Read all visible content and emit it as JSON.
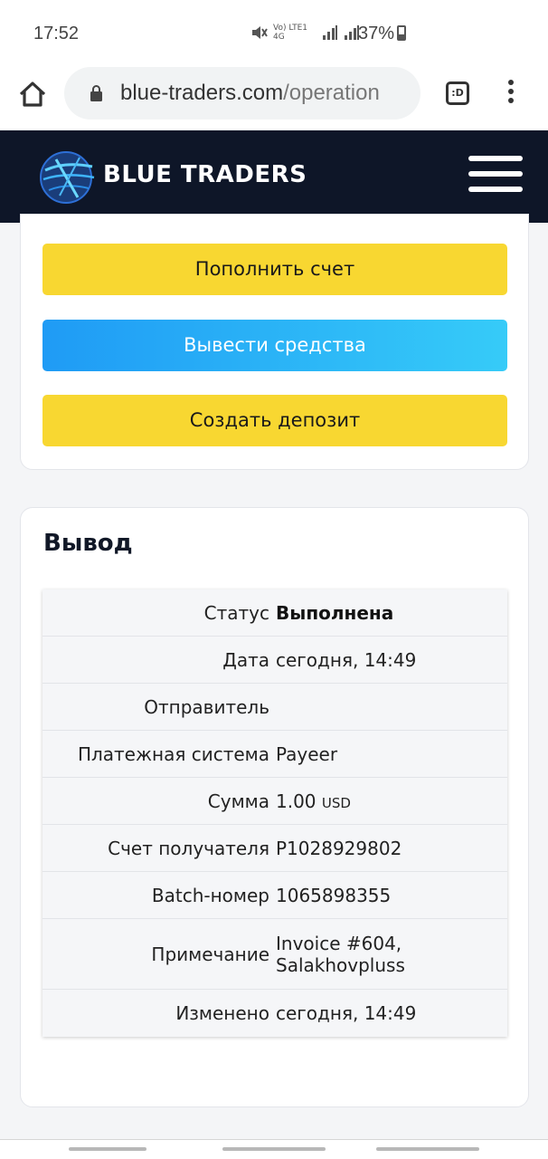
{
  "status_bar": {
    "time": "17:52",
    "network_icons": "Vo) LTE1 4G",
    "battery_percent": "37%"
  },
  "browser": {
    "url_main": "blue-traders.com",
    "url_rest": "/operation",
    "tabs_label": ":D"
  },
  "site": {
    "brand": "BLUE TRADERS"
  },
  "actions": {
    "deposit_label": "Пополнить счет",
    "withdraw_label": "Вывести средства",
    "create_deposit_label": "Создать депозит"
  },
  "withdrawal": {
    "title": "Вывод",
    "rows": [
      {
        "label": "Статус",
        "value": "Выполнена"
      },
      {
        "label": "Дата",
        "value": "сегодня, 14:49"
      },
      {
        "label": "Отправитель",
        "value": ""
      },
      {
        "label": "Платежная система",
        "value": "Payeer"
      },
      {
        "label": "Сумма",
        "value": "1.00",
        "unit": "USD"
      },
      {
        "label": "Счет получателя",
        "value": "P1028929802"
      },
      {
        "label": "Batch-номер",
        "value": "1065898355"
      },
      {
        "label": "Примечание",
        "value": "Invoice #604, Salakhovpluss"
      },
      {
        "label": "Изменено",
        "value": "сегодня, 14:49"
      }
    ]
  }
}
